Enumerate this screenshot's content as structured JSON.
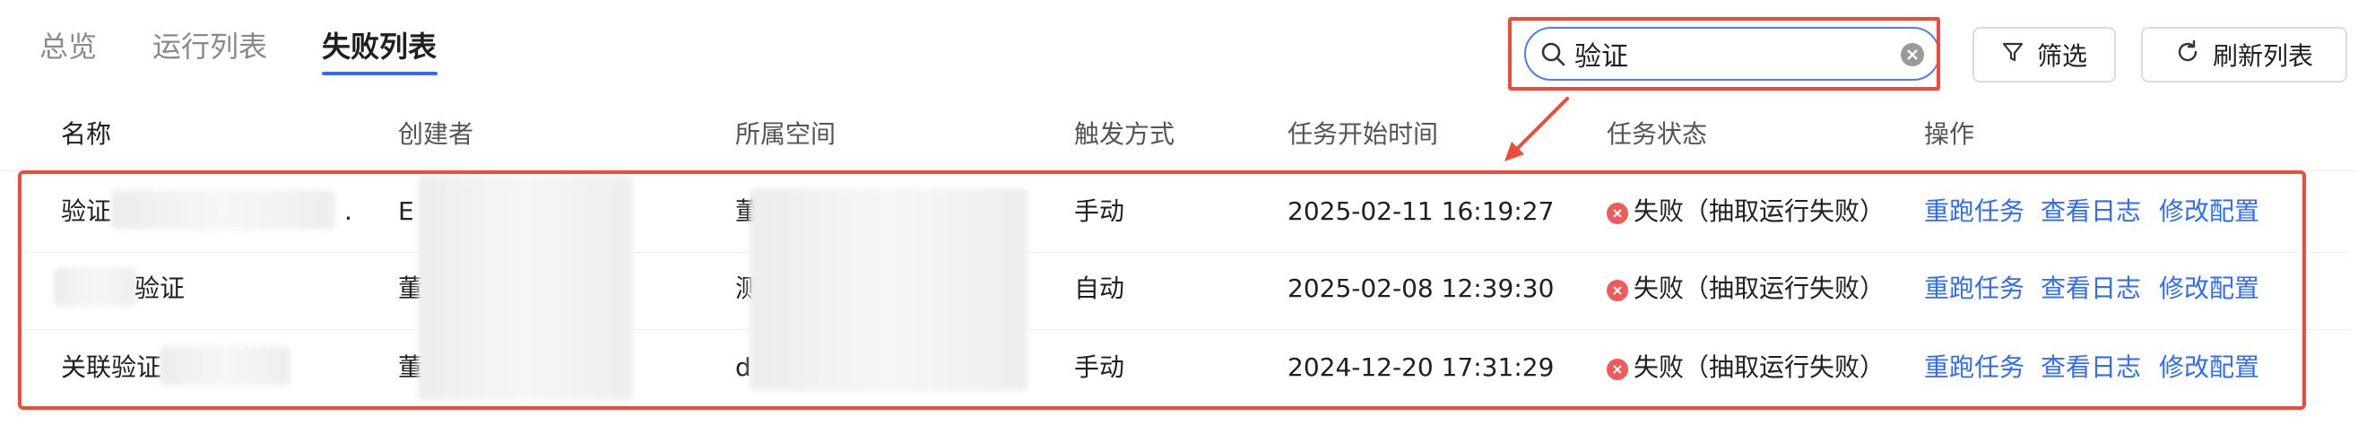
{
  "tabs": [
    {
      "label": "总览",
      "active": false
    },
    {
      "label": "运行列表",
      "active": false
    },
    {
      "label": "失败列表",
      "active": true
    }
  ],
  "search": {
    "value": "验证",
    "icon": "search-icon"
  },
  "toolbar": {
    "filter_label": "筛选",
    "refresh_label": "刷新列表"
  },
  "table": {
    "columns": [
      "名称",
      "创建者",
      "所属空间",
      "触发方式",
      "任务开始时间",
      "任务状态",
      "操作"
    ],
    "rows": [
      {
        "name": "验证",
        "name_tail": ".",
        "creator": "E",
        "space": "董",
        "trigger": "手动",
        "start_time": "2025-02-11 16:19:27",
        "status": "失败（抽取运行失败）"
      },
      {
        "name": "验证",
        "creator": "董",
        "space": "测",
        "trigger": "自动",
        "start_time": "2025-02-08 12:39:30",
        "status": "失败（抽取运行失败）"
      },
      {
        "name": "关联验证",
        "creator": "董",
        "space": "d",
        "trigger": "手动",
        "start_time": "2024-12-20 17:31:29",
        "status": "失败（抽取运行失败）"
      }
    ],
    "actions": [
      "重跑任务",
      "查看日志",
      "修改配置"
    ]
  },
  "colors": {
    "accent": "#2f6bff",
    "error": "#f05a5a",
    "annotation": "#ee4b3b"
  }
}
